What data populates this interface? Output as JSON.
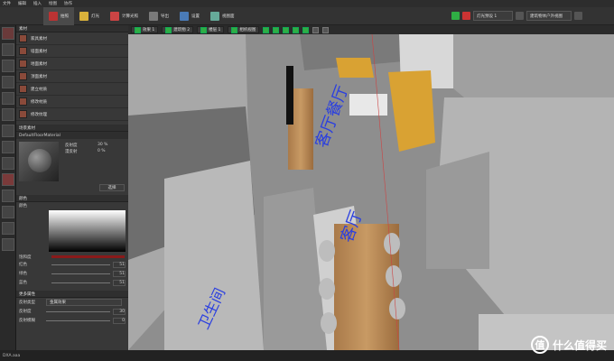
{
  "menu": {
    "items": [
      "文件",
      "编辑",
      "插入",
      "绘图",
      "协作"
    ]
  },
  "toolbar": {
    "tabs": [
      {
        "label": "拍照",
        "active": true
      },
      {
        "label": "灯光",
        "active": false
      },
      {
        "label": "计算光照",
        "active": false
      },
      {
        "label": "导出",
        "active": false
      },
      {
        "label": "设置",
        "active": false
      },
      {
        "label": "视图面",
        "active": false
      }
    ],
    "light_preset": "灯光预设 1",
    "view_preset": "建筑物体户外视图"
  },
  "panel": {
    "header": "素材",
    "materials": [
      "家具素材",
      "墙面素材",
      "地面素材",
      "顶面素材",
      "建立材质",
      "修改材质",
      "修改纹理"
    ],
    "material_section": "场景素材",
    "material_name": "DefaultFloorMaterial",
    "props": [
      {
        "label": "反射度",
        "value": "30 %"
      },
      {
        "label": "漫反射",
        "value": "0 %"
      }
    ],
    "select_btn": "选择",
    "color_section": "颜色",
    "color_label": "颜色",
    "params": [
      {
        "label": "饱和度",
        "value": ""
      },
      {
        "label": "红色",
        "value": "51"
      },
      {
        "label": "绿色",
        "value": "51"
      },
      {
        "label": "蓝色",
        "value": "51"
      }
    ],
    "adv_section": "更多属性",
    "adv": [
      {
        "label": "反射类型",
        "value": "金属效果"
      },
      {
        "label": "反射度",
        "value": "30"
      },
      {
        "label": "反射模糊",
        "value": "0"
      }
    ]
  },
  "viewbar": {
    "items": [
      "效果 1",
      "建筑物 2",
      "楼层 1",
      "相机视图"
    ]
  },
  "viewport": {
    "floor_text_1": "客厅餐厅",
    "floor_text_2": "客厅",
    "floor_text_3": "卫生间"
  },
  "status": {
    "text": "DXA.aaa"
  },
  "watermark": {
    "mark": "值",
    "text": "什么值得买"
  }
}
